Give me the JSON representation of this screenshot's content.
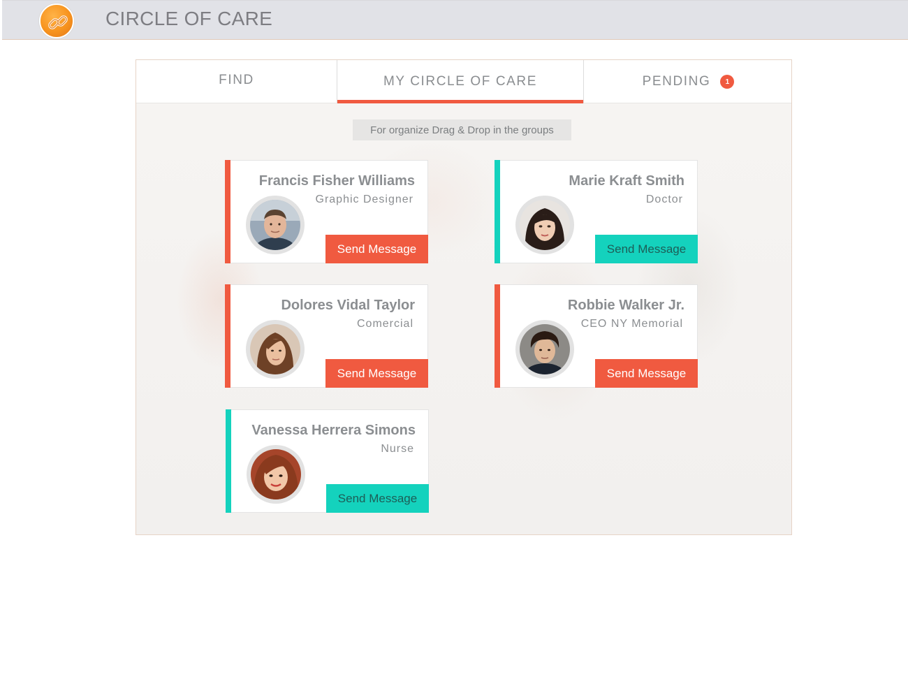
{
  "header": {
    "title": "CIRCLE OF CARE",
    "logo_icon": "chain-link-icon",
    "logo_color": "#f7931e"
  },
  "tabs": [
    {
      "label": "FIND",
      "active": false
    },
    {
      "label": "MY CIRCLE OF CARE",
      "active": true
    },
    {
      "label": "PENDING",
      "active": false,
      "badge": "1"
    }
  ],
  "hint": "For organize Drag & Drop in the groups",
  "colors": {
    "accent_red": "#f05a40",
    "accent_teal": "#14d2bd"
  },
  "contacts": [
    {
      "name": "Francis Fisher Williams",
      "role": "Graphic Designer",
      "button": "Send Message",
      "group": "red"
    },
    {
      "name": "Marie Kraft Smith",
      "role": "Doctor",
      "button": "Send Message",
      "group": "teal"
    },
    {
      "name": "Dolores Vidal Taylor",
      "role": "Comercial",
      "button": "Send Message",
      "group": "red"
    },
    {
      "name": "Robbie Walker Jr.",
      "role": "CEO NY Memorial",
      "button": "Send Message",
      "group": "red"
    },
    {
      "name": "Vanessa Herrera Simons",
      "role": "Nurse",
      "button": "Send Message",
      "group": "teal"
    }
  ]
}
